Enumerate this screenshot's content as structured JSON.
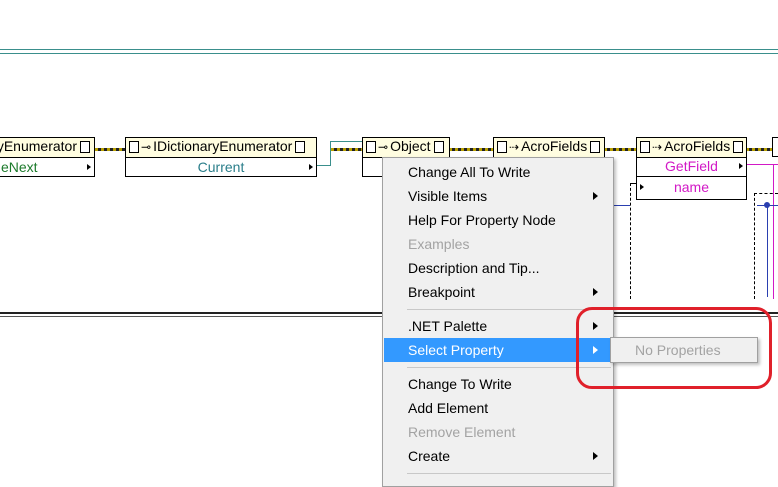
{
  "diagram": {
    "nodes": [
      {
        "title": "yEnumerator",
        "rows": [
          "eNext"
        ]
      },
      {
        "title": "IDictionaryEnumerator",
        "rows": [
          "Current"
        ]
      },
      {
        "title": "Object",
        "rows": [
          ""
        ]
      },
      {
        "title": "AcroFields",
        "rows": [
          ""
        ]
      },
      {
        "title": "AcroFields",
        "rows": [
          "GetField",
          "name"
        ]
      }
    ]
  },
  "context_menu": {
    "items": [
      {
        "label": "Change All To Write",
        "disabled": false,
        "submenu": false
      },
      {
        "label": "Visible Items",
        "disabled": false,
        "submenu": true
      },
      {
        "label": "Help For Property Node",
        "disabled": false,
        "submenu": false
      },
      {
        "label": "Examples",
        "disabled": true,
        "submenu": false
      },
      {
        "label": "Description and Tip...",
        "disabled": false,
        "submenu": false
      },
      {
        "label": "Breakpoint",
        "disabled": false,
        "submenu": true
      },
      {
        "label": ".NET Palette",
        "disabled": false,
        "submenu": true
      },
      {
        "label": "Select Property",
        "disabled": false,
        "submenu": true,
        "selected": true
      },
      {
        "label": "Change To Write",
        "disabled": false,
        "submenu": false
      },
      {
        "label": "Add Element",
        "disabled": false,
        "submenu": false
      },
      {
        "label": "Remove Element",
        "disabled": true,
        "submenu": false
      },
      {
        "label": "Create",
        "disabled": false,
        "submenu": true
      }
    ]
  },
  "submenu": {
    "items": [
      {
        "label": "No Properties",
        "disabled": true
      }
    ]
  },
  "colors": {
    "highlight": "#3399ff",
    "annotation": "#e0202a",
    "node_header": "#fffde0",
    "method_text": "#d219c6",
    "property_text": "#2a7e8a"
  }
}
